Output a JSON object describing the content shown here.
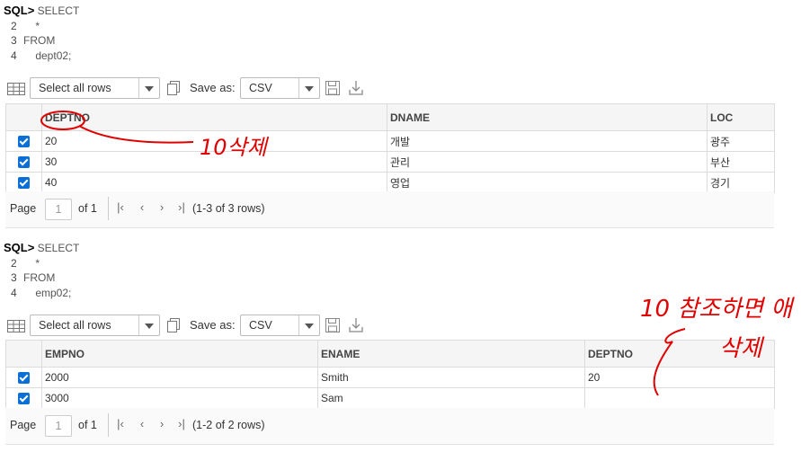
{
  "query1": {
    "prompt": "SQL>",
    "lines": [
      {
        "num": "",
        "text": "SELECT"
      },
      {
        "num": "2",
        "text": "    *"
      },
      {
        "num": "3",
        "text": "FROM"
      },
      {
        "num": "4",
        "text": "    dept02;"
      }
    ]
  },
  "query2": {
    "prompt": "SQL>",
    "lines": [
      {
        "num": "",
        "text": "SELECT"
      },
      {
        "num": "2",
        "text": "    *"
      },
      {
        "num": "3",
        "text": "FROM"
      },
      {
        "num": "4",
        "text": "    emp02;"
      }
    ]
  },
  "toolbar": {
    "select_label": "Select all rows",
    "save_as_label": "Save as:",
    "format_value": "CSV"
  },
  "result1": {
    "columns": [
      "DEPTNO",
      "DNAME",
      "LOC"
    ],
    "rows": [
      [
        "20",
        "개발",
        "광주"
      ],
      [
        "30",
        "관리",
        "부산"
      ],
      [
        "40",
        "영업",
        "경기"
      ]
    ],
    "pager": {
      "page_label": "Page",
      "page_value": "1",
      "of_label": "of 1",
      "range": "(1-3 of 3 rows)"
    }
  },
  "result2": {
    "columns": [
      "EMPNO",
      "ENAME",
      "DEPTNO"
    ],
    "rows": [
      [
        "2000",
        "Smith",
        "20"
      ],
      [
        "3000",
        "Sam",
        ""
      ]
    ],
    "pager": {
      "page_label": "Page",
      "page_value": "1",
      "of_label": "of 1",
      "range": "(1-2 of 2 rows)"
    }
  },
  "annotations": {
    "note1": "10삭제",
    "note2_line1": "10 참조하면 애",
    "note2_line2": "삭제",
    "color": "#e00000"
  },
  "colors": {
    "checkbox": "#0a6fd6",
    "header_bg": "#f5f5f5"
  }
}
